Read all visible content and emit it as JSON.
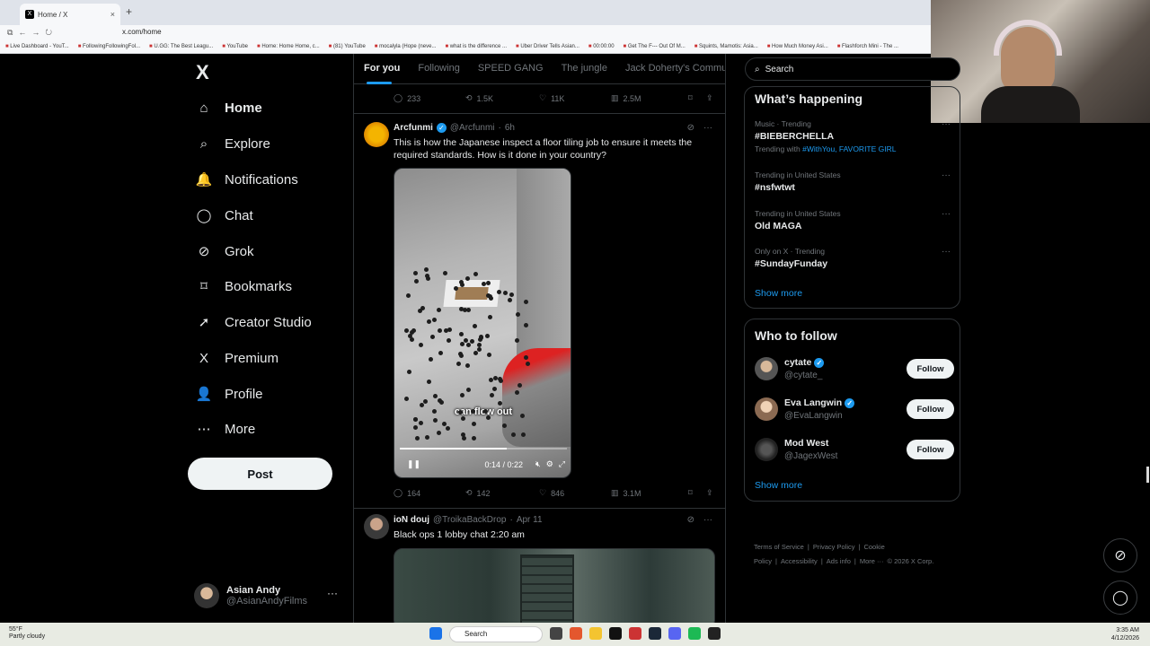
{
  "browser": {
    "tab_title": "Home / X",
    "tab_close": "×",
    "new_tab": "+",
    "url": "x.com/home",
    "bookmarks": [
      "Live Dashboard - YouT...",
      "FollowingFollowingFol...",
      "U.GG: The Best Leagu...",
      "YouTube",
      "Home: Home Home, c...",
      "(81) YouTube",
      "mocalyla (Hope (neve...",
      "what is the difference ...",
      "Uber Driver Tells Asian...",
      "00:00:00",
      "Get The F--- Out Of M...",
      "Squints, Mamotis: Asia...",
      "How Much Money Asi...",
      "Flashforch Mini - The ..."
    ]
  },
  "sidebar": {
    "brand": "X",
    "items": [
      {
        "label": "Home",
        "icon": "home-icon",
        "glyph": "⌂"
      },
      {
        "label": "Explore",
        "icon": "search-icon",
        "glyph": "⌕"
      },
      {
        "label": "Notifications",
        "icon": "bell-icon",
        "glyph": "🔔"
      },
      {
        "label": "Chat",
        "icon": "chat-icon",
        "glyph": "◯"
      },
      {
        "label": "Grok",
        "icon": "grok-icon",
        "glyph": "⊘"
      },
      {
        "label": "Bookmarks",
        "icon": "bookmark-icon",
        "glyph": "⌑"
      },
      {
        "label": "Creator Studio",
        "icon": "rocket-icon",
        "glyph": "➚"
      },
      {
        "label": "Premium",
        "icon": "x-logo-icon",
        "glyph": "X"
      },
      {
        "label": "Profile",
        "icon": "person-icon",
        "glyph": "👤"
      },
      {
        "label": "More",
        "icon": "more-circle-icon",
        "glyph": "⋯"
      }
    ],
    "post_label": "Post",
    "account": {
      "name": "Asian Andy",
      "handle": "@AsianAndyFilms",
      "more": "···"
    }
  },
  "feed": {
    "tabs": [
      "For you",
      "Following",
      "SPEED GANG",
      "The jungle",
      "Jack Doherty's Commun"
    ],
    "top_actions": {
      "replies": "233",
      "reposts": "1.5K",
      "likes": "11K",
      "views": "2.5M"
    },
    "tweet1": {
      "name": "Arcfunmi",
      "handle": "@Arcfunmi",
      "dot": "·",
      "time": "6h",
      "text": "This is how the Japanese inspect a floor tiling job to ensure it meets the required standards. How is it done in your country?",
      "video": {
        "caption": "can flow out",
        "time": "0:14 / 0:22",
        "progress": 0.64
      },
      "actions": {
        "replies": "164",
        "reposts": "142",
        "likes": "846",
        "views": "3.1M"
      }
    },
    "tweet2": {
      "name": "ioN douj",
      "handle": "@TroikaBackDrop",
      "dot": "·",
      "time": "Apr 11",
      "text": "Black ops 1 lobby chat 2:20 am"
    }
  },
  "right": {
    "search_placeholder": "Search",
    "happening_title": "What’s happening",
    "trends": [
      {
        "meta": "Music · Trending",
        "title": "#BIEBERCHELLA",
        "with_prefix": "Trending with",
        "with_tags": "#WithYou, FAVORITE GIRL"
      },
      {
        "meta": "Trending in United States",
        "title": "#nsfwtwt"
      },
      {
        "meta": "Trending in United States",
        "title": "Old MAGA"
      },
      {
        "meta": "Only on X · Trending",
        "title": "#SundayFunday"
      }
    ],
    "show_more": "Show more",
    "follow_title": "Who to follow",
    "follow": [
      {
        "name": "cytate",
        "handle": "@cytate_",
        "verified": true
      },
      {
        "name": "Eva Langwin",
        "handle": "@EvaLangwin",
        "verified": true
      },
      {
        "name": "Mod West",
        "handle": "@JagexWest",
        "verified": false
      }
    ],
    "follow_label": "Follow",
    "footer": [
      "Terms of Service",
      "|",
      "Privacy Policy",
      "|",
      "Cookie Policy",
      "|",
      "Accessibility",
      "|",
      "Ads info",
      "|",
      "More ···",
      "© 2026 X Corp."
    ]
  },
  "taskbar": {
    "weather_temp": "55°F",
    "weather_desc": "Partly cloudy",
    "search": "Search",
    "time": "3:35 AM",
    "date": "4/12/2026"
  },
  "colors": {
    "accent": "#1d9bf0",
    "background": "#000000",
    "border": "#2f3336",
    "muted": "#71767b"
  }
}
